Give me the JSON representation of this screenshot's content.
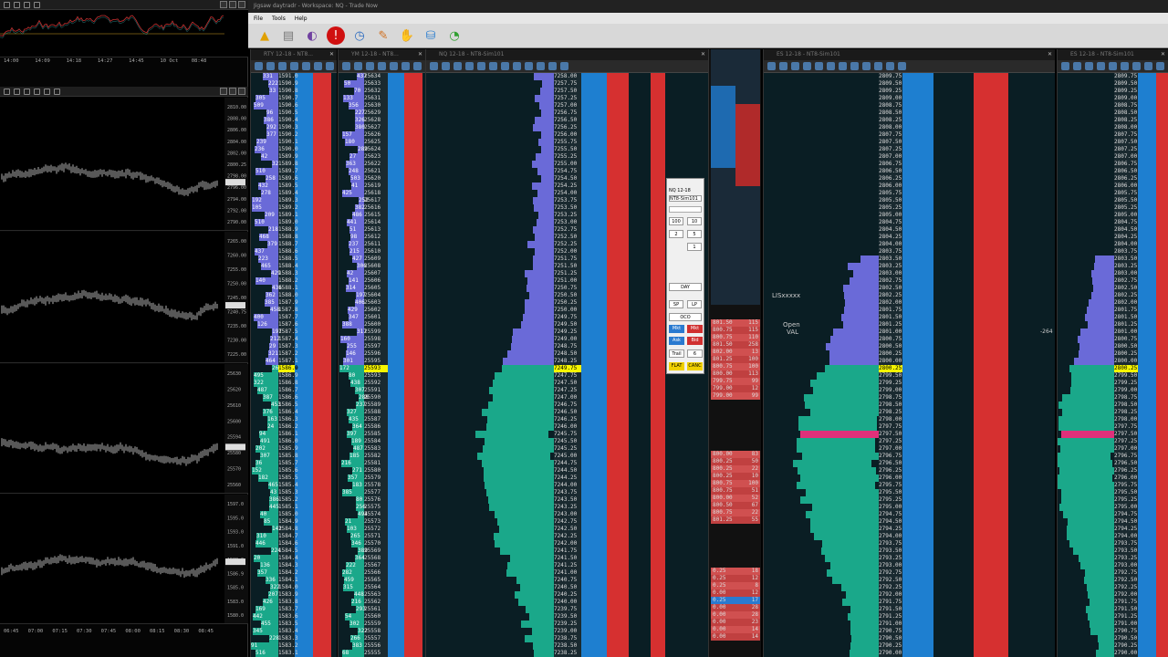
{
  "app": {
    "title": "Jigsaw daytradr - Workspace: NQ - Trade Now",
    "menu": [
      "File",
      "Tools",
      "Help"
    ]
  },
  "left_charts": {
    "top_time_ticks": [
      "14:00",
      "14:09",
      "14:18",
      "14:27",
      "14:45",
      "10 Oct",
      "08:48"
    ],
    "bottom_time_ticks": [
      "06:45",
      "07:00",
      "07:15",
      "07:30",
      "07:45",
      "08:00",
      "08:15",
      "08:30",
      "08:45"
    ],
    "pane_prices": [
      [
        "2810.00",
        "2808.00",
        "2806.00",
        "2804.00",
        "2802.00",
        "2800.25",
        "2798.00",
        "2796.00",
        "2794.00",
        "2792.00",
        "2790.00"
      ],
      [
        "7265.00",
        "7260.00",
        "7255.00",
        "7250.00",
        "7245.00",
        "7240.75",
        "7235.00",
        "7230.00",
        "7225.00"
      ],
      [
        "25630",
        "25620",
        "25610",
        "25600",
        "25594",
        "25580",
        "25570",
        "25560"
      ],
      [
        "1597.0",
        "1595.0",
        "1593.0",
        "1591.0",
        "1588.0",
        "1586.9",
        "1585.0",
        "1583.0",
        "1580.0"
      ]
    ]
  },
  "ladders": [
    {
      "title": "RTY 12-18 - NT8...",
      "highlight_price": "1586.9"
    },
    {
      "title": "YM 12-18 - NT8...",
      "highlight_price": "25593"
    },
    {
      "title": "NQ 12-18 - NT8-Sim101",
      "highlight_price": "7249.75"
    },
    {
      "title": "ES 12-18 - NT8-Sim101",
      "highlight_price": "2800.25"
    },
    {
      "title": "ES 12-18 - NT8-Sim101",
      "highlight_price": "2800.25"
    }
  ],
  "es_labels": {
    "lis": "LISxxxxx",
    "open": "Open",
    "val": "VAL",
    "value_264": "-264"
  },
  "order_panel": {
    "symbol": "NQ 12-18",
    "account": "NT8-Sim101",
    "qty": "1",
    "tif": "DAY",
    "buttons": [
      "Mkt",
      "Mkt",
      "Ask",
      "Bid",
      "FLAT",
      "CANC",
      "Trail",
      "6",
      "OCO",
      "SP",
      "LP",
      "100",
      "10",
      "2",
      "5"
    ]
  },
  "dom_blocks": [
    {
      "rows": [
        [
          "801.50",
          "115"
        ],
        [
          "800.75",
          "115"
        ],
        [
          "800.75",
          "110"
        ],
        [
          "801.50",
          "258"
        ],
        [
          "802.00",
          "13"
        ],
        [
          "801.25",
          "100"
        ],
        [
          "800.75",
          "100"
        ],
        [
          "800.00",
          "113"
        ],
        [
          "799.75",
          "99"
        ],
        [
          "799.00",
          "12"
        ],
        [
          "799.00",
          "99"
        ]
      ]
    },
    {
      "rows": [
        [
          "800.00",
          "83"
        ],
        [
          "800.25",
          "50"
        ],
        [
          "800.25",
          "22"
        ],
        [
          "800.25",
          "10"
        ],
        [
          "800.75",
          "100"
        ],
        [
          "800.75",
          "51"
        ],
        [
          "800.00",
          "52"
        ],
        [
          "800.50",
          "67"
        ],
        [
          "800.75",
          "22"
        ],
        [
          "801.25",
          "55"
        ]
      ]
    },
    {
      "rows": [
        [
          "0.25",
          "18"
        ],
        [
          "0.25",
          "12"
        ],
        [
          "0.25",
          "8"
        ],
        [
          "0.00",
          "12"
        ],
        [
          "0.25",
          "17"
        ],
        [
          "0.00",
          "28"
        ],
        [
          "0.00",
          "28"
        ],
        [
          "0.00",
          "23"
        ],
        [
          "0.00",
          "14"
        ],
        [
          "0.00",
          "14"
        ]
      ]
    }
  ],
  "colors": {
    "bid": "#1e7fd0",
    "ask": "#d63030",
    "volume_green": "#1aa88a",
    "volume_purple": "#6a6ad8",
    "highlight": "#f5f500"
  }
}
